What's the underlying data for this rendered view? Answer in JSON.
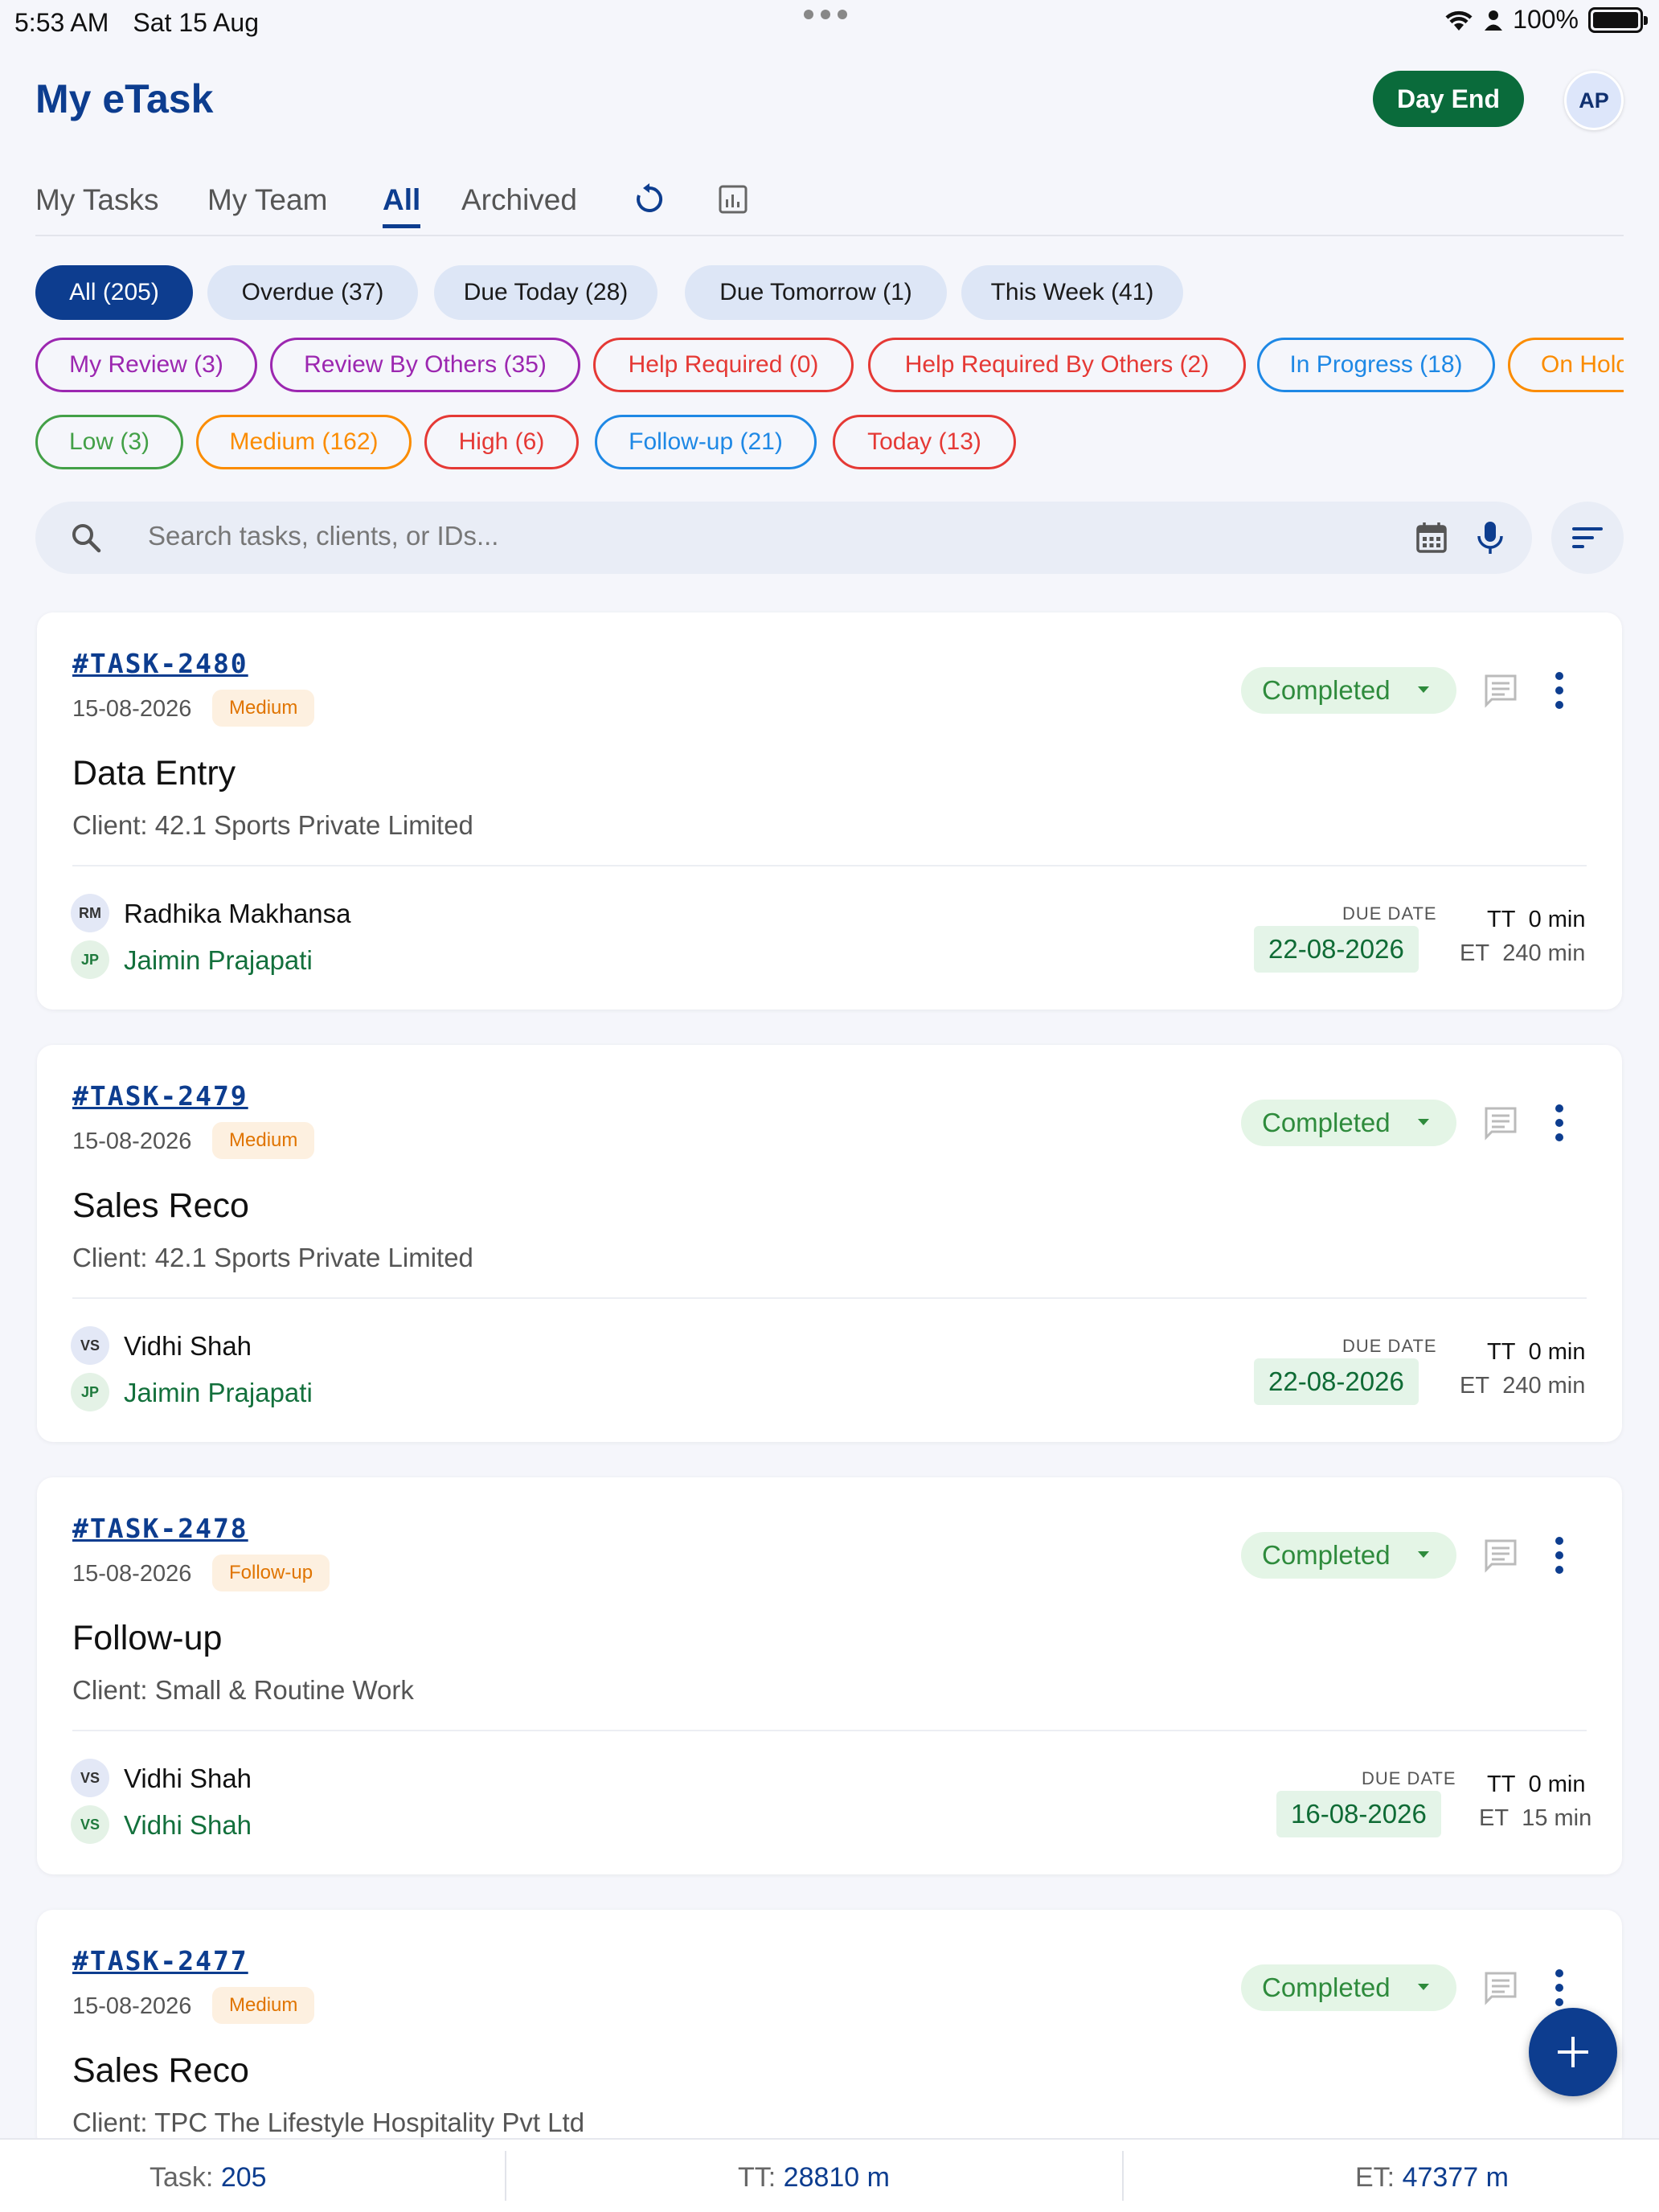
{
  "statusbar": {
    "time": "5:53 AM",
    "date": "Sat 15 Aug",
    "battery": "100%"
  },
  "header": {
    "title": "My eTask",
    "day_end_label": "Day End",
    "avatar_initials": "AP"
  },
  "tabs": [
    {
      "label": "My Tasks"
    },
    {
      "label": "My Team"
    },
    {
      "label": "All",
      "active": true
    },
    {
      "label": "Archived"
    }
  ],
  "tab_icons": [
    "refresh-icon",
    "report-icon"
  ],
  "filters_row1": [
    {
      "label": "All (205)",
      "selected": true
    },
    {
      "label": "Overdue (37)"
    },
    {
      "label": "Due Today (28)"
    },
    {
      "label": "Due Tomorrow (1)"
    },
    {
      "label": "This Week (41)"
    }
  ],
  "filters_row2": [
    {
      "label": "My Review (3)",
      "color": "#9c27b0"
    },
    {
      "label": "Review By Others (35)",
      "color": "#9c27b0"
    },
    {
      "label": "Help Required (0)",
      "color": "#e53935"
    },
    {
      "label": "Help Required By Others (2)",
      "color": "#e53935"
    },
    {
      "label": "In Progress (18)",
      "color": "#1e88e5"
    },
    {
      "label": "On Hold",
      "color": "#fb8c00"
    }
  ],
  "filters_row3": [
    {
      "label": "Low (3)",
      "color": "#43a047"
    },
    {
      "label": "Medium (162)",
      "color": "#fb8c00"
    },
    {
      "label": "High (6)",
      "color": "#e53935"
    },
    {
      "label": "Follow-up (21)",
      "color": "#1e88e5"
    },
    {
      "label": "Today (13)",
      "color": "#e53935"
    }
  ],
  "search": {
    "placeholder": "Search tasks, clients, or IDs..."
  },
  "tasks": [
    {
      "id": "#TASK-2480",
      "date": "15-08-2026",
      "priority": "Medium",
      "title": "Data Entry",
      "client": "Client: 42.1 Sports Private Limited",
      "status": "Completed",
      "assignee_initials": "RM",
      "assignee": "Radhika Makhansa",
      "owner_initials": "JP",
      "owner": "Jaimin Prajapati",
      "due_label": "DUE DATE",
      "due": "22-08-2026",
      "tt_label": "TT",
      "tt": "0 min",
      "et_label": "ET",
      "et": "240 min"
    },
    {
      "id": "#TASK-2479",
      "date": "15-08-2026",
      "priority": "Medium",
      "title": "Sales Reco",
      "client": "Client: 42.1 Sports Private Limited",
      "status": "Completed",
      "assignee_initials": "VS",
      "assignee": "Vidhi Shah",
      "owner_initials": "JP",
      "owner": "Jaimin Prajapati",
      "due_label": "DUE DATE",
      "due": "22-08-2026",
      "tt_label": "TT",
      "tt": "0 min",
      "et_label": "ET",
      "et": "240 min"
    },
    {
      "id": "#TASK-2478",
      "date": "15-08-2026",
      "priority": "Follow-up",
      "title": "Follow-up",
      "client": "Client: Small & Routine Work",
      "status": "Completed",
      "assignee_initials": "VS",
      "assignee": "Vidhi Shah",
      "owner_initials": "VS",
      "owner": "Vidhi Shah",
      "due_label": "DUE DATE",
      "due": "16-08-2026",
      "tt_label": "TT",
      "tt": "0 min",
      "et_label": "ET",
      "et": "15 min"
    },
    {
      "id": "#TASK-2477",
      "date": "15-08-2026",
      "priority": "Medium",
      "title": "Sales Reco",
      "client": "Client: TPC The Lifestyle Hospitality Pvt Ltd",
      "status": "Completed"
    }
  ],
  "footer": {
    "task_label": "Task:",
    "task_value": "205",
    "tt_label": "TT:",
    "tt_value": "28810 m",
    "et_label": "ET:",
    "et_value": "47377 m"
  }
}
